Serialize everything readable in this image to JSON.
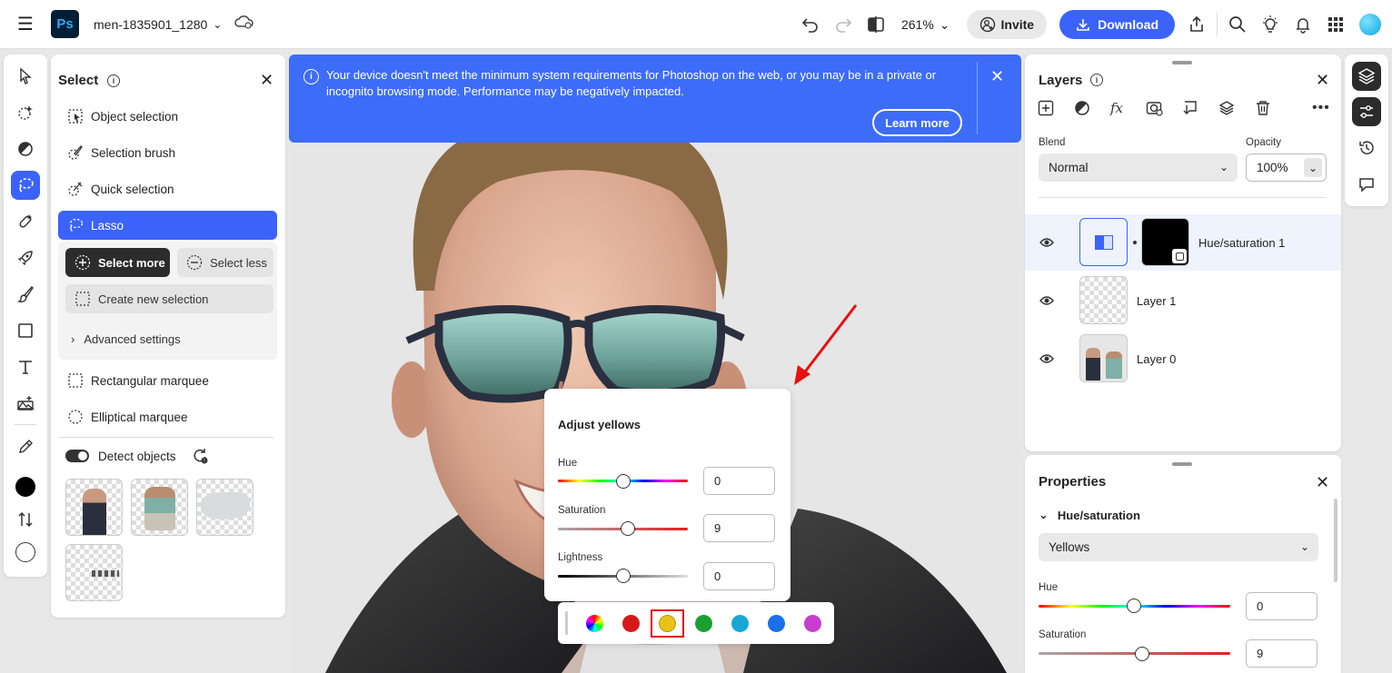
{
  "topbar": {
    "doc_name": "men-1835901_1280",
    "app_logo": "Ps",
    "zoom": "261%",
    "invite_label": "Invite",
    "download_label": "Download"
  },
  "select_panel": {
    "title": "Select",
    "items": {
      "object_selection": "Object selection",
      "selection_brush": "Selection brush",
      "quick_selection": "Quick selection",
      "lasso": "Lasso",
      "rectangular_marquee": "Rectangular marquee",
      "elliptical_marquee": "Elliptical marquee"
    },
    "select_more": "Select more",
    "select_less": "Select less",
    "create_new": "Create new selection",
    "advanced": "Advanced settings",
    "detect_objects": "Detect objects"
  },
  "banner": {
    "message": "Your device doesn't meet the minimum system requirements for Photoshop on the web, or you may be in a private or incognito browsing mode. Performance may be negatively impacted.",
    "learn_more": "Learn more"
  },
  "adjust": {
    "title": "Adjust yellows",
    "hue_label": "Hue",
    "hue_value": "0",
    "saturation_label": "Saturation",
    "saturation_value": "9",
    "lightness_label": "Lightness",
    "lightness_value": "0"
  },
  "swatches": {
    "colors": [
      "master",
      "#d61a1a",
      "#e8c21a",
      "#18a030",
      "#18a8d8",
      "#1a70e8",
      "#c83cd0"
    ],
    "selected": 2
  },
  "layers": {
    "title": "Layers",
    "blend_label": "Blend",
    "blend_value": "Normal",
    "opacity_label": "Opacity",
    "opacity_value": "100%",
    "items": [
      {
        "name": "Hue/saturation 1"
      },
      {
        "name": "Layer 1"
      },
      {
        "name": "Layer 0"
      }
    ]
  },
  "properties": {
    "title": "Properties",
    "section": "Hue/saturation",
    "channel": "Yellows",
    "hue_label": "Hue",
    "hue_value": "0",
    "saturation_label": "Saturation",
    "saturation_value": "9"
  },
  "colors": {
    "accent": "#3b63fb",
    "banner": "#3d6cf8",
    "foreground_swatch": "#000000",
    "background_swatch": "#ffffff"
  }
}
